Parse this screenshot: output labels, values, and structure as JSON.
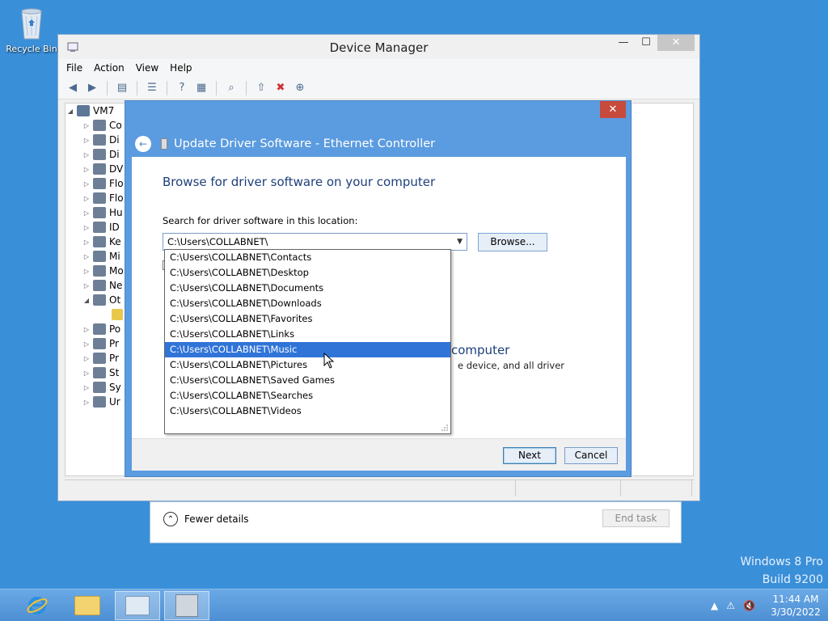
{
  "desktop": {
    "recycle_bin_label": "Recycle Bin",
    "watermark_line1": "Windows 8 Pro",
    "watermark_line2": "Build 9200"
  },
  "task_manager": {
    "fewer_details": "Fewer details",
    "end_task": "End task"
  },
  "device_manager": {
    "title": "Device Manager",
    "menu": [
      "File",
      "Action",
      "View",
      "Help"
    ],
    "tree_root": "VM7",
    "tree_items": [
      "Co",
      "Di",
      "Di",
      "DV",
      "Flo",
      "Flo",
      "Hu",
      "ID",
      "Ke",
      "Mi",
      "Mo",
      "Ne",
      "Ot",
      "",
      "Po",
      "Pr",
      "Pr",
      "St",
      "Sy",
      "Ur"
    ]
  },
  "dialog": {
    "title": "Update Driver Software - Ethernet Controller",
    "heading": "Browse for driver software on your computer",
    "search_label": "Search for driver software in this location:",
    "path_value": "C:\\Users\\COLLABNET\\",
    "browse_label": "Browse...",
    "heading2_fragment": "computer",
    "text2_fragment": "e device, and all driver",
    "next_label": "Next",
    "cancel_label": "Cancel",
    "close_label": "✕"
  },
  "dropdown": {
    "options": [
      "C:\\Users\\COLLABNET\\Contacts",
      "C:\\Users\\COLLABNET\\Desktop",
      "C:\\Users\\COLLABNET\\Documents",
      "C:\\Users\\COLLABNET\\Downloads",
      "C:\\Users\\COLLABNET\\Favorites",
      "C:\\Users\\COLLABNET\\Links",
      "C:\\Users\\COLLABNET\\Music",
      "C:\\Users\\COLLABNET\\Pictures",
      "C:\\Users\\COLLABNET\\Saved Games",
      "C:\\Users\\COLLABNET\\Searches",
      "C:\\Users\\COLLABNET\\Videos"
    ],
    "selected_index": 6
  },
  "taskbar": {
    "time": "11:44 AM",
    "date": "3/30/2022"
  },
  "colors": {
    "desktop": "#3a8fd9",
    "dialog_frame": "#5b9be0",
    "selection": "#3074d8",
    "heading": "#1e3f7a"
  }
}
